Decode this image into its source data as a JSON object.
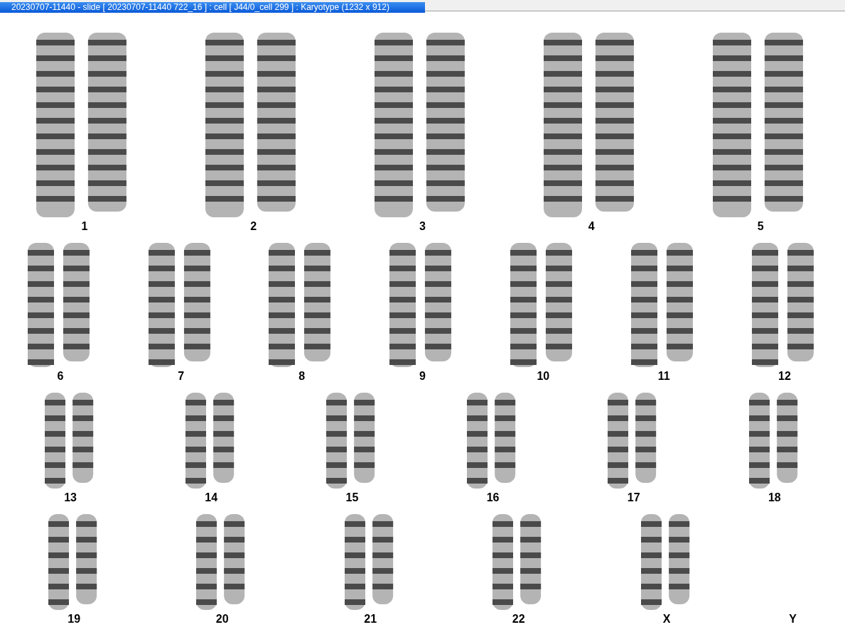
{
  "window": {
    "title": "20230707-11440 - slide [ 20230707-11440 722_16 ] : cell [ J44/0_cell 299 ] : Karyotype  (1232 x 912)"
  },
  "karyotype": {
    "rows": [
      {
        "pairs": [
          {
            "label": "1",
            "kind": "pair"
          },
          {
            "label": "2",
            "kind": "pair"
          },
          {
            "label": "3",
            "kind": "pair"
          },
          {
            "label": "4",
            "kind": "pair"
          },
          {
            "label": "5",
            "kind": "pair"
          }
        ]
      },
      {
        "pairs": [
          {
            "label": "6",
            "kind": "pair"
          },
          {
            "label": "7",
            "kind": "pair"
          },
          {
            "label": "8",
            "kind": "pair"
          },
          {
            "label": "9",
            "kind": "pair"
          },
          {
            "label": "10",
            "kind": "pair"
          },
          {
            "label": "11",
            "kind": "pair"
          },
          {
            "label": "12",
            "kind": "pair"
          }
        ]
      },
      {
        "pairs": [
          {
            "label": "13",
            "kind": "pair"
          },
          {
            "label": "14",
            "kind": "pair"
          },
          {
            "label": "15",
            "kind": "pair"
          },
          {
            "label": "16",
            "kind": "pair"
          },
          {
            "label": "17",
            "kind": "pair"
          },
          {
            "label": "18",
            "kind": "pair"
          }
        ]
      },
      {
        "pairs": [
          {
            "label": "19",
            "kind": "pair"
          },
          {
            "label": "20",
            "kind": "pair"
          },
          {
            "label": "21",
            "kind": "pair"
          },
          {
            "label": "22",
            "kind": "pair"
          },
          {
            "label": "X",
            "kind": "pair"
          },
          {
            "label": "Y",
            "kind": "empty"
          }
        ]
      }
    ]
  }
}
